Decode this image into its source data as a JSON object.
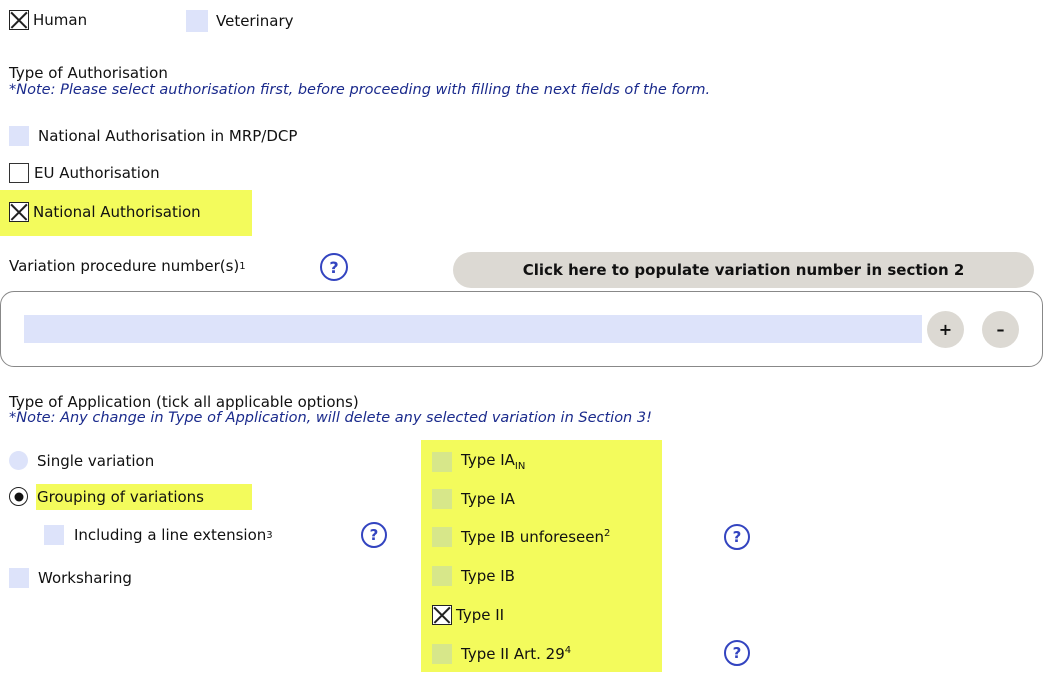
{
  "domain_section": {
    "human": {
      "label": "Human",
      "checked": true
    },
    "veterinary": {
      "label": "Veterinary",
      "checked": false
    }
  },
  "authorisation": {
    "title": "Type of Authorisation",
    "note": "*Note: Please select authorisation first, before proceeding with filling the next fields of the form.",
    "options": [
      {
        "label": "National Authorisation in MRP/DCP",
        "checked": false
      },
      {
        "label": "EU Authorisation",
        "checked": false
      },
      {
        "label": "National Authorisation",
        "checked": true
      }
    ]
  },
  "variation_number": {
    "label": "Variation procedure number(s)",
    "footnote": "1",
    "help_icon": "?",
    "populate_button": "Click here to populate variation number in section 2",
    "input_value": "",
    "add_button": "+",
    "remove_button": "–"
  },
  "application": {
    "title": "Type of Application (tick all applicable options)",
    "note": "*Note: Any change in Type of Application, will delete any selected variation in Section 3!",
    "radios": [
      {
        "label": "Single variation",
        "selected": false
      },
      {
        "label": "Grouping of variations",
        "selected": true
      }
    ],
    "line_extension": {
      "label": "Including a line extension",
      "footnote": "3",
      "checked": false
    },
    "worksharing": {
      "label": "Worksharing",
      "checked": false
    },
    "types": [
      {
        "label": "Type IA",
        "subscript": "IN",
        "checked": false
      },
      {
        "label": "Type IA",
        "checked": false
      },
      {
        "label": "Type IB unforeseen",
        "footnote": "2",
        "checked": false
      },
      {
        "label": "Type IB",
        "checked": false
      },
      {
        "label": "Type II",
        "checked": true
      },
      {
        "label": "Type II Art. 29",
        "footnote": "4",
        "checked": false
      }
    ]
  },
  "colors": {
    "highlight": "#f3fb5c",
    "unchecked_box": "#dde3fa",
    "note_text": "#1a2a8c",
    "help_icon": "#3344c0",
    "button_bg": "#dcd9d3"
  }
}
